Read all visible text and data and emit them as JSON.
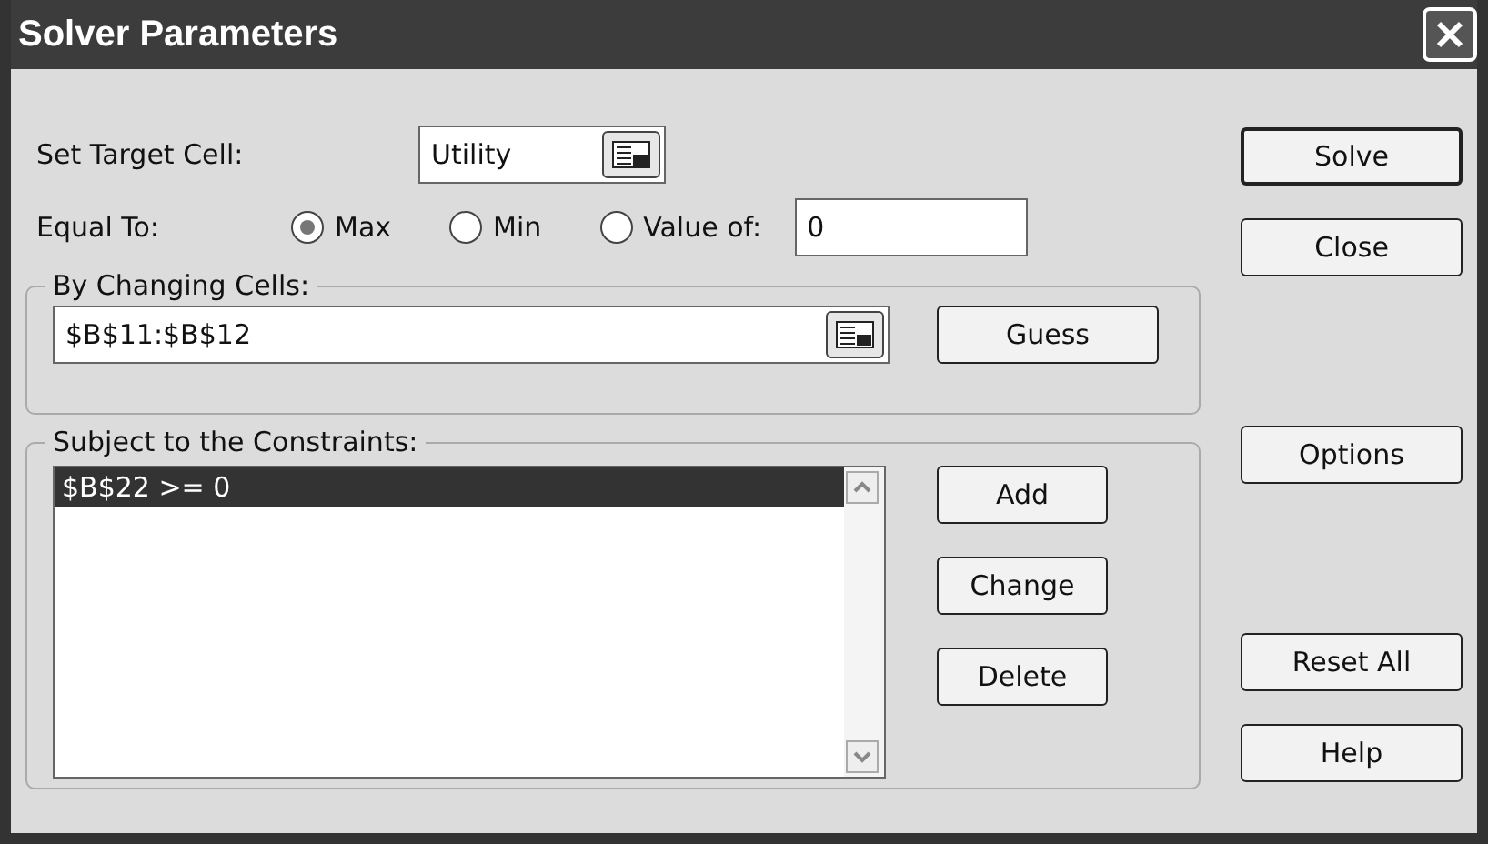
{
  "window": {
    "title": "Solver Parameters"
  },
  "target_cell": {
    "label": "Set Target Cell:",
    "value": "Utility"
  },
  "equal_to": {
    "label": "Equal To:",
    "options": [
      {
        "label": "Max",
        "selected": true
      },
      {
        "label": "Min",
        "selected": false
      },
      {
        "label": "Value of:",
        "selected": false
      }
    ],
    "value_field": "0"
  },
  "changing_cells": {
    "label": "By Changing Cells:",
    "value": "$B$11:$B$12",
    "button": "Guess"
  },
  "constraints": {
    "label": "Subject to the Constraints:",
    "items": [
      {
        "text": "$B$22 >= 0",
        "selected": true
      }
    ],
    "buttons": [
      "Add",
      "Change",
      "Delete"
    ]
  },
  "side_buttons": [
    {
      "label": "Solve",
      "default": true
    },
    {
      "label": "Close",
      "default": false
    },
    {
      "label": "Options",
      "default": false
    },
    {
      "label": "Reset All",
      "default": false
    },
    {
      "label": "Help",
      "default": false
    }
  ]
}
